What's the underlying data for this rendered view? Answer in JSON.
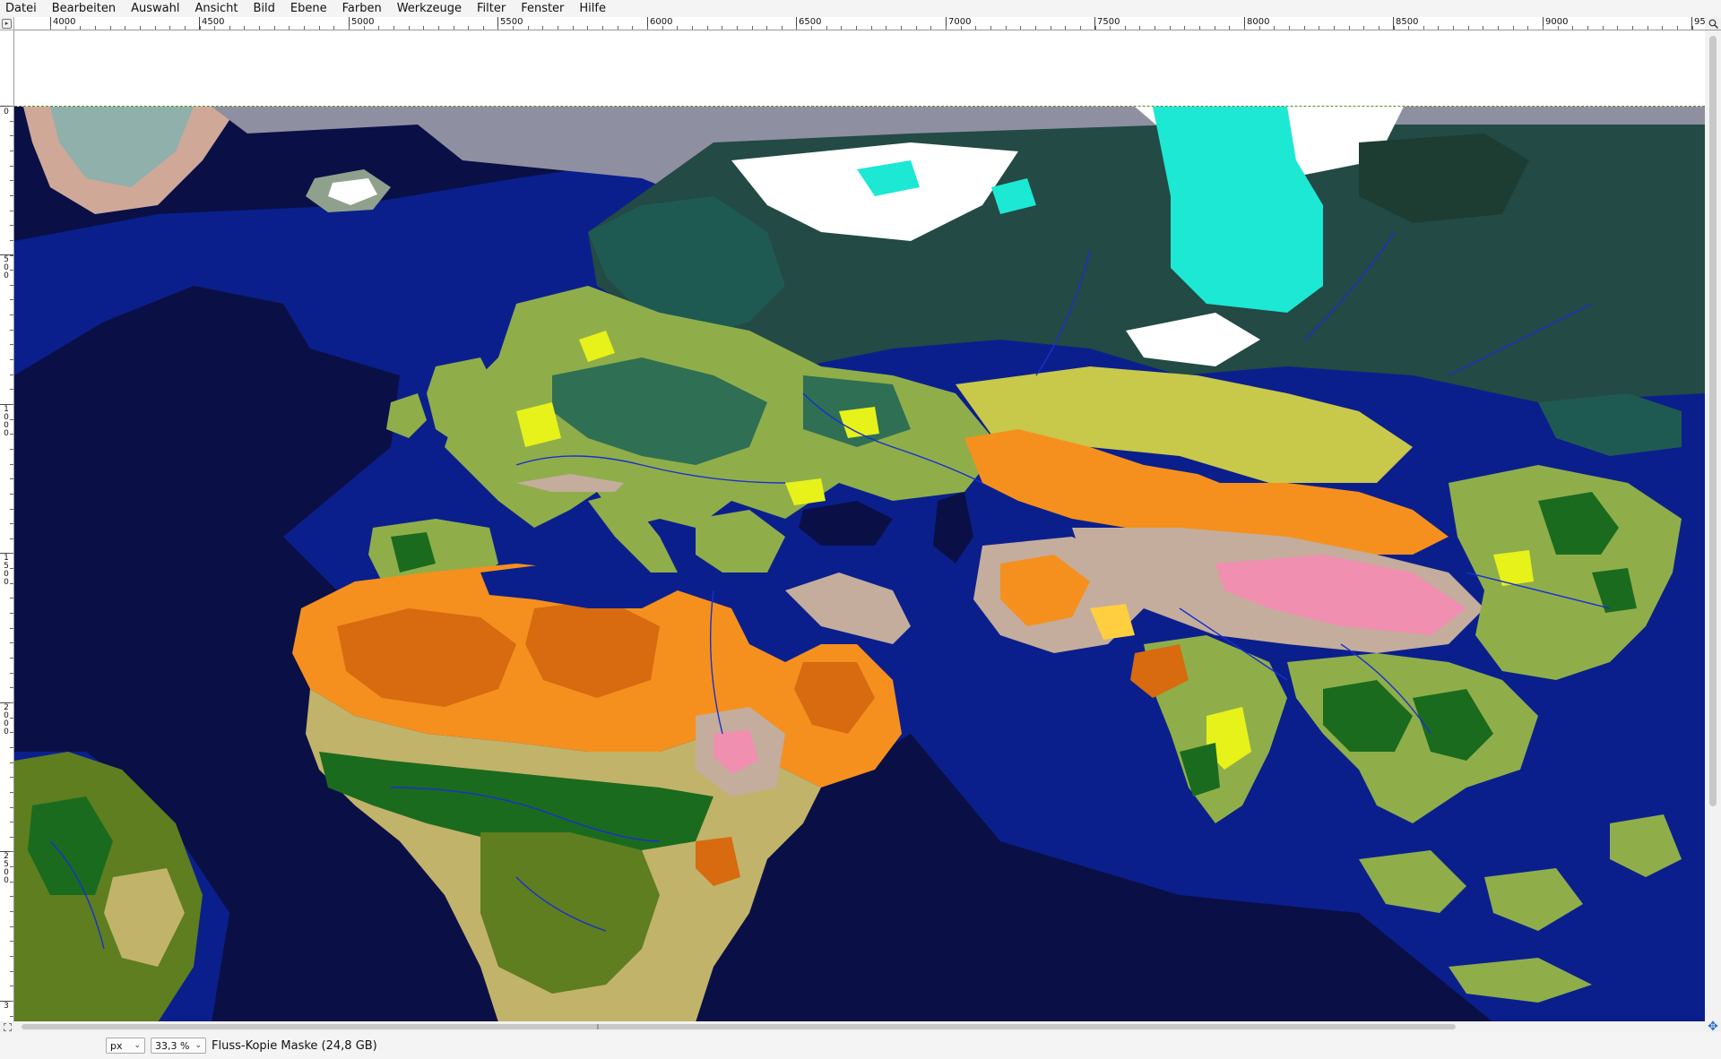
{
  "menubar": {
    "items": [
      "Datei",
      "Bearbeiten",
      "Auswahl",
      "Ansicht",
      "Bild",
      "Ebene",
      "Farben",
      "Werkzeuge",
      "Filter",
      "Fenster",
      "Hilfe"
    ]
  },
  "rulers": {
    "horizontal_labels": [
      "4000",
      "4500",
      "5000",
      "5500",
      "6000",
      "6500",
      "7000",
      "7500",
      "8000",
      "8500",
      "9000",
      "95"
    ],
    "vertical_labels": [
      "0",
      "500",
      "1000",
      "1500",
      "2000",
      "2500",
      "3"
    ]
  },
  "statusbar": {
    "unit": "px",
    "zoom": "33,3 %",
    "layer_info": "Fluss-Kopie Maske (24,8 GB)"
  },
  "icons": {
    "corner": "triangle-right-icon",
    "zoom_lock": "magnify-icon",
    "navigate": "move-arrows-icon",
    "quickmask": "dashed-square-icon"
  },
  "colors": {
    "ocean_deep": "#0a1046",
    "ocean_shelf": "#0b1f8c",
    "desert": "#f5901e",
    "desert_dark": "#d86a10",
    "savanna": "#c2b36a",
    "forest_green": "#1b6b1e",
    "grassland": "#8fae4a",
    "taiga": "#234a44",
    "tundra_gray": "#8f8fa2",
    "ice": "#ffffff",
    "highland_pink": "#f08fb0",
    "mountain_tan": "#c4ad9c",
    "lime": "#e6f21a",
    "cyan": "#1ce8d4",
    "river": "#1a2fd0"
  }
}
